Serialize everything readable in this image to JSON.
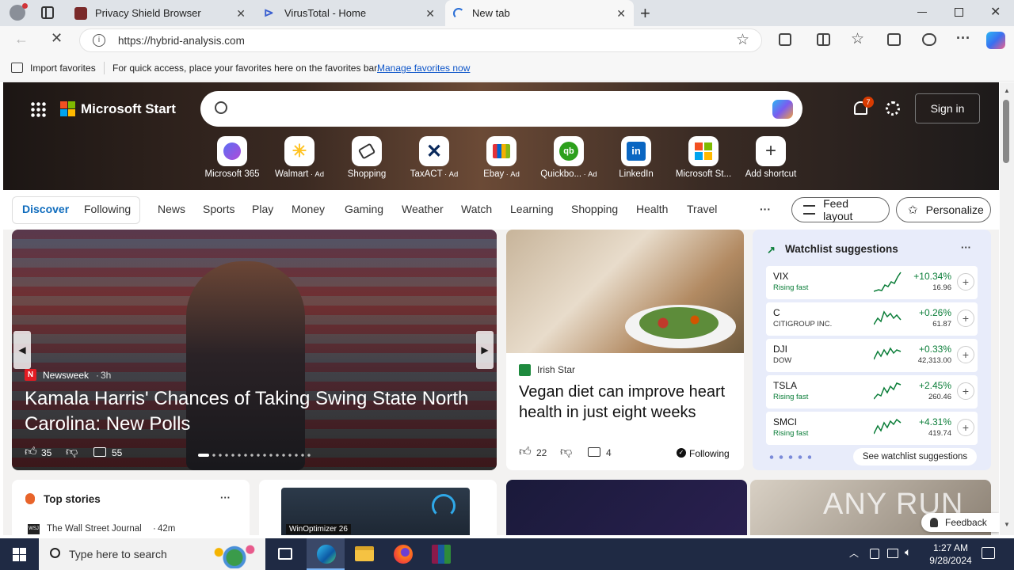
{
  "tabs": [
    {
      "title": "Privacy Shield Browser"
    },
    {
      "title": "VirusTotal - Home"
    },
    {
      "title": "New tab"
    }
  ],
  "address": {
    "url": "https://hybrid-analysis.com"
  },
  "favbar": {
    "import": "Import favorites",
    "hint": "For quick access, place your favorites here on the favorites bar.",
    "manage": "Manage favorites now"
  },
  "header": {
    "brand": "Microsoft Start",
    "notif_count": "7",
    "signin": "Sign in"
  },
  "quick_links": [
    {
      "label": "Microsoft 365"
    },
    {
      "label": "Walmart",
      "ad": "Ad"
    },
    {
      "label": "Shopping"
    },
    {
      "label": "TaxACT",
      "ad": "Ad"
    },
    {
      "label": "Ebay",
      "ad": "Ad"
    },
    {
      "label": "Quickbo...",
      "ad": "Ad"
    },
    {
      "label": "LinkedIn"
    },
    {
      "label": "Microsoft St..."
    },
    {
      "label": "Add shortcut"
    }
  ],
  "nav": {
    "discover": "Discover",
    "following": "Following",
    "items": [
      "News",
      "Sports",
      "Play",
      "Money",
      "Gaming",
      "Weather",
      "Watch",
      "Learning",
      "Shopping",
      "Health",
      "Travel"
    ],
    "more": "···",
    "feed_layout": "Feed layout",
    "personalize": "Personalize"
  },
  "hero_story": {
    "source": "Newsweek",
    "age": "3h",
    "title": "Kamala Harris' Chances of Taking Swing State North Carolina: New Polls",
    "likes": "35",
    "comments": "55"
  },
  "story2": {
    "source": "Irish Star",
    "title": "Vegan diet can improve heart health in just eight weeks",
    "likes": "22",
    "comments": "4",
    "following": "Following"
  },
  "watchlist": {
    "title": "Watchlist suggestions",
    "more": "···",
    "see": "See watchlist suggestions",
    "rows": [
      {
        "symbol": "VIX",
        "sub": "Rising fast",
        "pct": "+10.34%",
        "price": "16.96",
        "rising": true
      },
      {
        "symbol": "C",
        "sub": "CITIGROUP INC.",
        "pct": "+0.26%",
        "price": "61.87",
        "rising": false
      },
      {
        "symbol": "DJI",
        "sub": "DOW",
        "pct": "+0.33%",
        "price": "42,313.00",
        "rising": false
      },
      {
        "symbol": "TSLA",
        "sub": "Rising fast",
        "pct": "+2.45%",
        "price": "260.46",
        "rising": true
      },
      {
        "symbol": "SMCI",
        "sub": "Rising fast",
        "pct": "+4.31%",
        "price": "419.74",
        "rising": true
      }
    ]
  },
  "top_stories": {
    "title": "Top stories",
    "more": "···",
    "item_source": "The Wall Street Journal",
    "item_age": "42m"
  },
  "promo": {
    "brand": "WinOptimizer 26"
  },
  "feedback": "Feedback",
  "watermark": "ANY RUN",
  "taskbar": {
    "search_placeholder": "Type here to search",
    "time": "1:27 AM",
    "date": "9/28/2024"
  }
}
